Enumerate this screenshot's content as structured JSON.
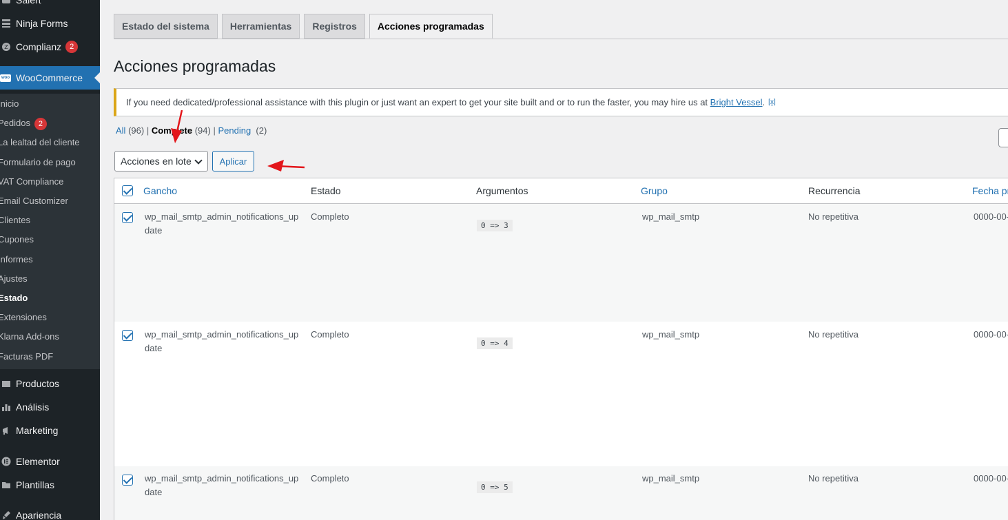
{
  "sidebar": {
    "top_items": [
      {
        "label": "Salert",
        "icon": "plugin-icon"
      },
      {
        "label": "Ninja Forms",
        "icon": "forms-icon"
      },
      {
        "label": "Complianz",
        "icon": "complianz-icon",
        "badge": "2"
      }
    ],
    "woocommerce": {
      "label": "WooCommerce",
      "icon": "woo-icon",
      "logo_text": "woo"
    },
    "submenu": [
      {
        "label": "Inicio"
      },
      {
        "label": "Pedidos",
        "badge": "2"
      },
      {
        "label": "La lealtad del cliente"
      },
      {
        "label": "Formulario de pago"
      },
      {
        "label": "VAT Compliance"
      },
      {
        "label": "Email Customizer"
      },
      {
        "label": "Clientes"
      },
      {
        "label": "Cupones"
      },
      {
        "label": "Informes"
      },
      {
        "label": "Ajustes"
      },
      {
        "label": "Estado",
        "current": true
      },
      {
        "label": "Extensiones"
      },
      {
        "label": "Klarna Add-ons"
      },
      {
        "label": "Facturas PDF"
      }
    ],
    "bottom_items": [
      {
        "label": "Productos",
        "icon": "products-icon"
      },
      {
        "label": "Análisis",
        "icon": "analytics-icon"
      },
      {
        "label": "Marketing",
        "icon": "megaphone-icon"
      },
      {
        "label": "Elementor",
        "icon": "elementor-icon"
      },
      {
        "label": "Plantillas",
        "icon": "folder-icon"
      },
      {
        "label": "Apariencia",
        "icon": "brush-icon"
      }
    ]
  },
  "tabs": [
    "Estado del sistema",
    "Herramientas",
    "Registros",
    "Acciones programadas"
  ],
  "active_tab": "Acciones programadas",
  "page_title": "Acciones programadas",
  "notice": {
    "text": "If you need dedicated/professional assistance with this plugin or just want an expert to get your site built and or to run the faster, you may hire us at",
    "link": "Bright Vessel",
    "after": ".",
    "dismiss": "[x]"
  },
  "filters": {
    "all": "All",
    "all_count": "(96)",
    "complete": "Complete",
    "complete_count": "(94)",
    "pending": "Pending",
    "pending_count": "(2)",
    "sep": "|"
  },
  "bulk": {
    "select_value": "Acciones en lote",
    "apply": "Aplicar"
  },
  "table": {
    "columns": [
      "Gancho",
      "Estado",
      "Argumentos",
      "Grupo",
      "Recurrencia",
      "Fecha pr"
    ],
    "rows": [
      {
        "hook_line1": "wp_mail_smtp_admin_notifications_up",
        "hook_line2": "date",
        "status": "Completo",
        "args": "0 => 3",
        "group": "wp_mail_smtp",
        "recurrence": "No repetitiva",
        "date": "0000-00-"
      },
      {
        "hook_line1": "wp_mail_smtp_admin_notifications_up",
        "hook_line2": "date",
        "status": "Completo",
        "args": "0 => 4",
        "group": "wp_mail_smtp",
        "recurrence": "No repetitiva",
        "date": "0000-00-"
      },
      {
        "hook_line1": "wp_mail_smtp_admin_notifications_up",
        "hook_line2": "date",
        "status": "Completo",
        "args": "0 => 5",
        "group": "wp_mail_smtp",
        "recurrence": "No repetitiva",
        "date": "0000-00-"
      }
    ]
  },
  "colors": {
    "accent": "#2271b1",
    "sidebar": "#1d2327",
    "arrow": "#e3161b",
    "notice_border": "#dba617"
  }
}
